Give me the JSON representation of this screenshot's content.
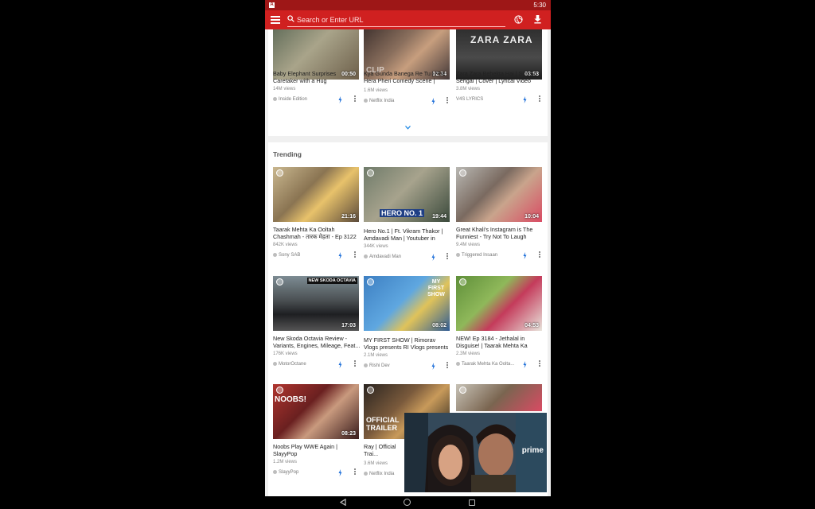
{
  "status_bar": {
    "app_badge": "A",
    "time": "5:30"
  },
  "app_bar": {
    "search_placeholder": "Search or Enter URL",
    "menu_icon": "hamburger-menu-icon",
    "globe_icon": "globe-icon",
    "download_icon": "download-icon"
  },
  "top_videos": [
    {
      "duration": "00:50",
      "title": "Baby Elephant Surprises Caretaker with a Hug",
      "views": "14M views",
      "channel": "Inside Edition"
    },
    {
      "duration": "02:34",
      "title": "Kya Gunda Banega Re Tu | Phir Hera Pheri Comedy Scene | Netflix...",
      "views": "1.6M views",
      "channel": "Netflix India"
    },
    {
      "duration": "03:53",
      "title": "Zara Zara Behekta Hai | Simran Sehgal | Cover | Lyrical Video",
      "views": "3.8M views",
      "channel": "V4S LYRICS",
      "thumb_text": "ZARA ZARA"
    }
  ],
  "trending": {
    "title": "Trending",
    "videos": [
      {
        "duration": "21:16",
        "title": "Taarak Mehta Ka Ooltah Chashmah - तारक मेहता - Ep 3122 -...",
        "views": "842K views",
        "channel": "Sony SAB"
      },
      {
        "duration": "19:44",
        "title": "Hero No.1 | Ft. Vikram Thakor | Amdavadi Man | Youtuber in Movi...",
        "views": "344K views",
        "channel": "Amdavadi Man",
        "thumb_text": "HERO NO. 1"
      },
      {
        "duration": "10:04",
        "title": "Great Khali's Instagram is The Funniest - Try Not To Laugh Chall...",
        "views": "9.4M views",
        "channel": "Triggered Insaan"
      },
      {
        "duration": "17:03",
        "title": "New Skoda Octavia Review - Variants, Engines, Mileage, Feat...",
        "views": "176K views",
        "channel": "MotorOctane",
        "thumb_text": "NEW SKODA OCTAVIA"
      },
      {
        "duration": "08:02",
        "title": "MY FIRST SHOW | Rimorav Vlogs presents RI Vlogs presents The Ri...",
        "views": "2.1M views",
        "channel": "Rishi Dev",
        "thumb_text": "MY FIRST SHOW"
      },
      {
        "duration": "04:53",
        "title": "NEW! Ep 3184 - Jethalal in Disguise! | Taarak Mehta Ka Oolt...",
        "views": "2.3M views",
        "channel": "Taarak Mehta Ka Oolta..."
      },
      {
        "duration": "08:23",
        "title": "Noobs Play WWE Again | SlayyPop",
        "views": "1.2M views",
        "channel": "SlayyPop",
        "thumb_text": "NOOBS!"
      },
      {
        "duration": "",
        "title": "Ray | Official Trai... Bajpayee, Ali Faz...",
        "views": "3.6M views",
        "channel": "Netflix India",
        "thumb_text": "OFFICIAL TRAILER"
      }
    ]
  },
  "pip": {
    "brand": "prime"
  }
}
